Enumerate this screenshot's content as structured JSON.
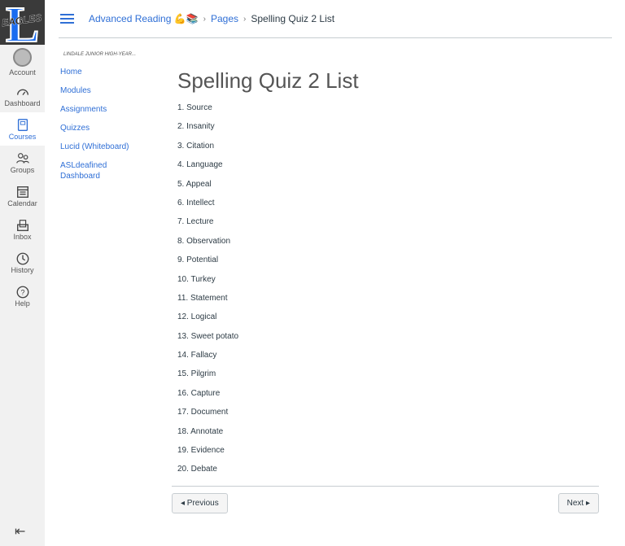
{
  "logo": {
    "text": "L",
    "sub": "EAGLES"
  },
  "global_nav": [
    {
      "label": "Account"
    },
    {
      "label": "Dashboard"
    },
    {
      "label": "Courses"
    },
    {
      "label": "Groups"
    },
    {
      "label": "Calendar"
    },
    {
      "label": "Inbox"
    },
    {
      "label": "History"
    },
    {
      "label": "Help"
    }
  ],
  "breadcrumb": {
    "course": "Advanced Reading 💪📚",
    "pages": "Pages",
    "current": "Spelling Quiz 2 List"
  },
  "course_nav": {
    "term": "LINDALE JUNIOR HIGH-Year...",
    "items": [
      "Home",
      "Modules",
      "Assignments",
      "Quizzes",
      "Lucid (Whiteboard)",
      "ASLdeafined Dashboard"
    ]
  },
  "page": {
    "title": "Spelling Quiz 2 List",
    "items": [
      "1. Source",
      "2. Insanity",
      "3. Citation",
      "4. Language",
      "5. Appeal",
      "6. Intellect",
      "7. Lecture",
      "8. Observation",
      "9. Potential",
      "10. Turkey",
      "11. Statement",
      "12. Logical",
      "13. Sweet potato",
      "14. Fallacy",
      "15. Pilgrim",
      "16. Capture",
      "17. Document",
      "18. Annotate",
      "19. Evidence",
      "20. Debate"
    ]
  },
  "pager": {
    "previous": "◂ Previous",
    "next": "Next ▸"
  }
}
